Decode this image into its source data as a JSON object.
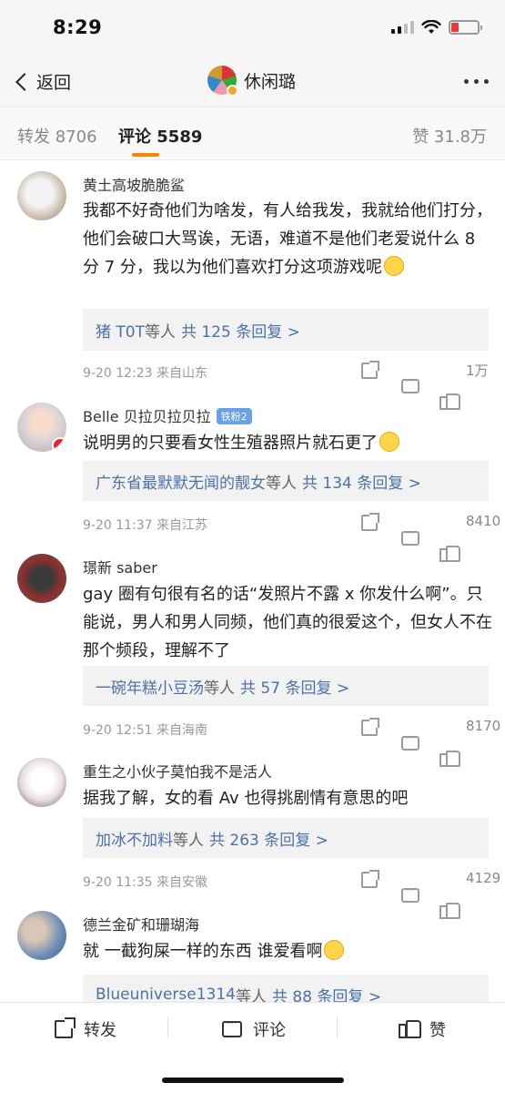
{
  "status": {
    "time": "8:29",
    "battery_color": "#e5383b"
  },
  "nav": {
    "back_label": "返回",
    "title": "休闲璐"
  },
  "tabs": [
    {
      "label": "转发 8706"
    },
    {
      "label": "评论 5589"
    },
    {
      "label": "赞 31.8万"
    }
  ],
  "accent_color": "#ff8200",
  "comments": [
    {
      "name": "黄土高坡脆脆鲨",
      "text": "我都不好奇他们为啥发，有人给我发，我就给他们打分，他们会破口大骂诶，无语，难道不是他们老爱说什么 8 分 7 分，我以为他们喜欢打分这项游戏呢",
      "reply_users": "猪 T0T",
      "reply_suffix": "等人",
      "reply_count": "共 125 条回复 >",
      "time": "9-20 12:23",
      "source": "来自山东",
      "likes": "1万"
    },
    {
      "name": "Belle 贝拉贝拉贝拉",
      "badge": "铁粉2",
      "text": "说明男的只要看女性生殖器照片就石更了",
      "reply_users": "广东省最默默无闻的靓女",
      "reply_suffix": "等人",
      "reply_count": "共 134 条回复 >",
      "time": "9-20 11:37",
      "source": "来自江苏",
      "likes": "8410"
    },
    {
      "name": "璟新 saber",
      "text": "gay 圈有句很有名的话“发照片不露 x 你发什么啊”。只能说，男人和男人同频，他们真的很爱这个，但女人不在那个频段，理解不了",
      "reply_users": "一碗年糕小豆汤",
      "reply_suffix": "等人",
      "reply_count": "共 57 条回复 >",
      "time": "9-20 12:51",
      "source": "来自海南",
      "likes": "8170"
    },
    {
      "name": "重生之小伙子莫怕我不是活人",
      "text": "据我了解，女的看 Av 也得挑剧情有意思的吧",
      "reply_users": "加冰不加料",
      "reply_suffix": "等人",
      "reply_count": "共 263 条回复 >",
      "time": "9-20 11:35",
      "source": "来自安徽",
      "likes": "4129"
    },
    {
      "name": "德兰金矿和珊瑚海",
      "text": "就 一截狗屎一样的东西 谁爱看啊",
      "reply_users": "Blueuniverse1314",
      "reply_suffix": "等人",
      "reply_count": "共 88 条回复 >"
    }
  ],
  "bottom_bar": {
    "share": "转发",
    "comment": "评论",
    "like": "赞"
  },
  "icons": [
    "back-chevron-icon",
    "more-icon",
    "share-icon",
    "comment-icon",
    "like-icon",
    "smile-emoji-icon"
  ]
}
